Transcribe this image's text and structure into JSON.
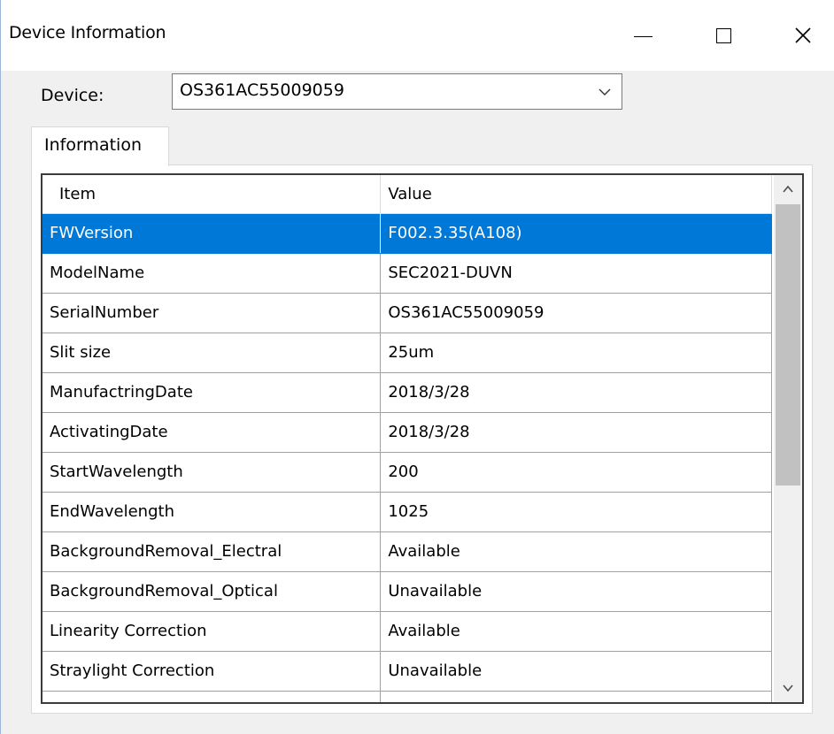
{
  "window": {
    "title": "Device Information"
  },
  "device": {
    "label": "Device:",
    "selected": "OS361AC55009059"
  },
  "tabs": [
    {
      "label": "Information"
    }
  ],
  "table": {
    "columns": [
      "Item",
      "Value"
    ],
    "rows": [
      {
        "item": "FWVersion",
        "value": "F002.3.35(A108)"
      },
      {
        "item": "ModelName",
        "value": "SEC2021-DUVN"
      },
      {
        "item": "SerialNumber",
        "value": "OS361AC55009059"
      },
      {
        "item": "Slit size",
        "value": "25um"
      },
      {
        "item": "ManufactringDate",
        "value": "2018/3/28"
      },
      {
        "item": "ActivatingDate",
        "value": "2018/3/28"
      },
      {
        "item": "StartWavelength",
        "value": "200"
      },
      {
        "item": "EndWavelength",
        "value": "1025"
      },
      {
        "item": "BackgroundRemoval_Electral",
        "value": "Available"
      },
      {
        "item": "BackgroundRemoval_Optical",
        "value": "Unavailable"
      },
      {
        "item": "Linearity Correction",
        "value": "Available"
      },
      {
        "item": "Straylight Correction",
        "value": "Unavailable"
      }
    ],
    "selected_row": 0
  },
  "colors": {
    "selection": "#0078d7",
    "window_bg": "#f0f0f0"
  }
}
